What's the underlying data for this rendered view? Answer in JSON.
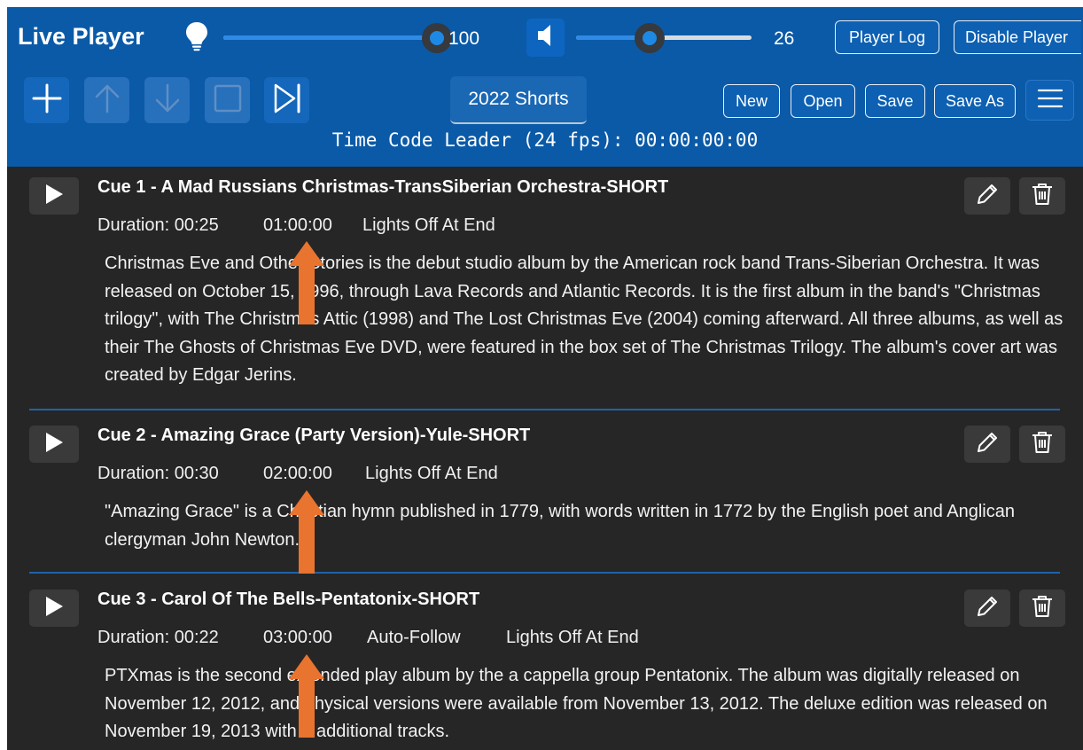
{
  "app": {
    "title": "Live Player"
  },
  "header": {
    "brightness": {
      "icon": "lightbulb-icon",
      "value": 100,
      "display": "100"
    },
    "volume": {
      "icon": "speaker-icon",
      "value": 26,
      "display": "26",
      "level": 0.42
    },
    "player_log_label": "Player Log",
    "disable_player_label": "Disable Player",
    "toolbar": {
      "add_icon": "plus-icon",
      "move_up_icon": "arrow-up-icon",
      "move_down_icon": "arrow-down-icon",
      "stop_icon": "stop-icon",
      "next_icon": "skip-next-icon"
    },
    "playlist_name": "2022 Shorts",
    "file_buttons": {
      "new": "New",
      "open": "Open",
      "save": "Save",
      "save_as": "Save As"
    },
    "menu_icon": "hamburger-menu-icon",
    "timecode": "Time Code Leader (24 fps): 00:00:00:00"
  },
  "cues": [
    {
      "title": "Cue 1 - A Mad Russians Christmas-TransSiberian Orchestra-SHORT",
      "duration": "Duration: 00:25",
      "timecode": "01:00:00",
      "flags": [
        "Lights Off At End"
      ],
      "description": "Christmas Eve and Other Stories is the debut studio album by the American rock band Trans-Siberian Orchestra. It was released on October 15, 1996, through Lava Records and Atlantic Records. It is the first album in the band's \"Christmas trilogy\", with The Christmas Attic (1998) and The Lost Christmas Eve (2004) coming afterward. All three albums, as well as their The Ghosts of Christmas Eve DVD, were featured in the box set of The Christmas Trilogy. The album's cover art was created by Edgar Jerins."
    },
    {
      "title": "Cue 2 - Amazing Grace (Party Version)-Yule-SHORT",
      "duration": "Duration: 00:30",
      "timecode": "02:00:00",
      "flags": [
        "Lights Off At End"
      ],
      "description": "\"Amazing Grace\" is a Christian hymn published in 1779, with words written in 1772 by the English poet and Anglican clergyman John Newton."
    },
    {
      "title": "Cue 3 - Carol Of The Bells-Pentatonix-SHORT",
      "duration": "Duration: 00:22",
      "timecode": "03:00:00",
      "flags": [
        "Auto-Follow",
        "Lights Off At End"
      ],
      "description": "PTXmas is the second extended play album by the a cappella group Pentatonix. The album was digitally released on November 12, 2012, and physical versions were available from November 13, 2012. The deluxe edition was released on November 19, 2013 with 2 additional tracks."
    }
  ],
  "colors": {
    "header_bg": "#0a5aa8",
    "content_bg": "#262626",
    "annotation_arrow": "#e8742f",
    "slider_fill": "#2f8ae6"
  }
}
